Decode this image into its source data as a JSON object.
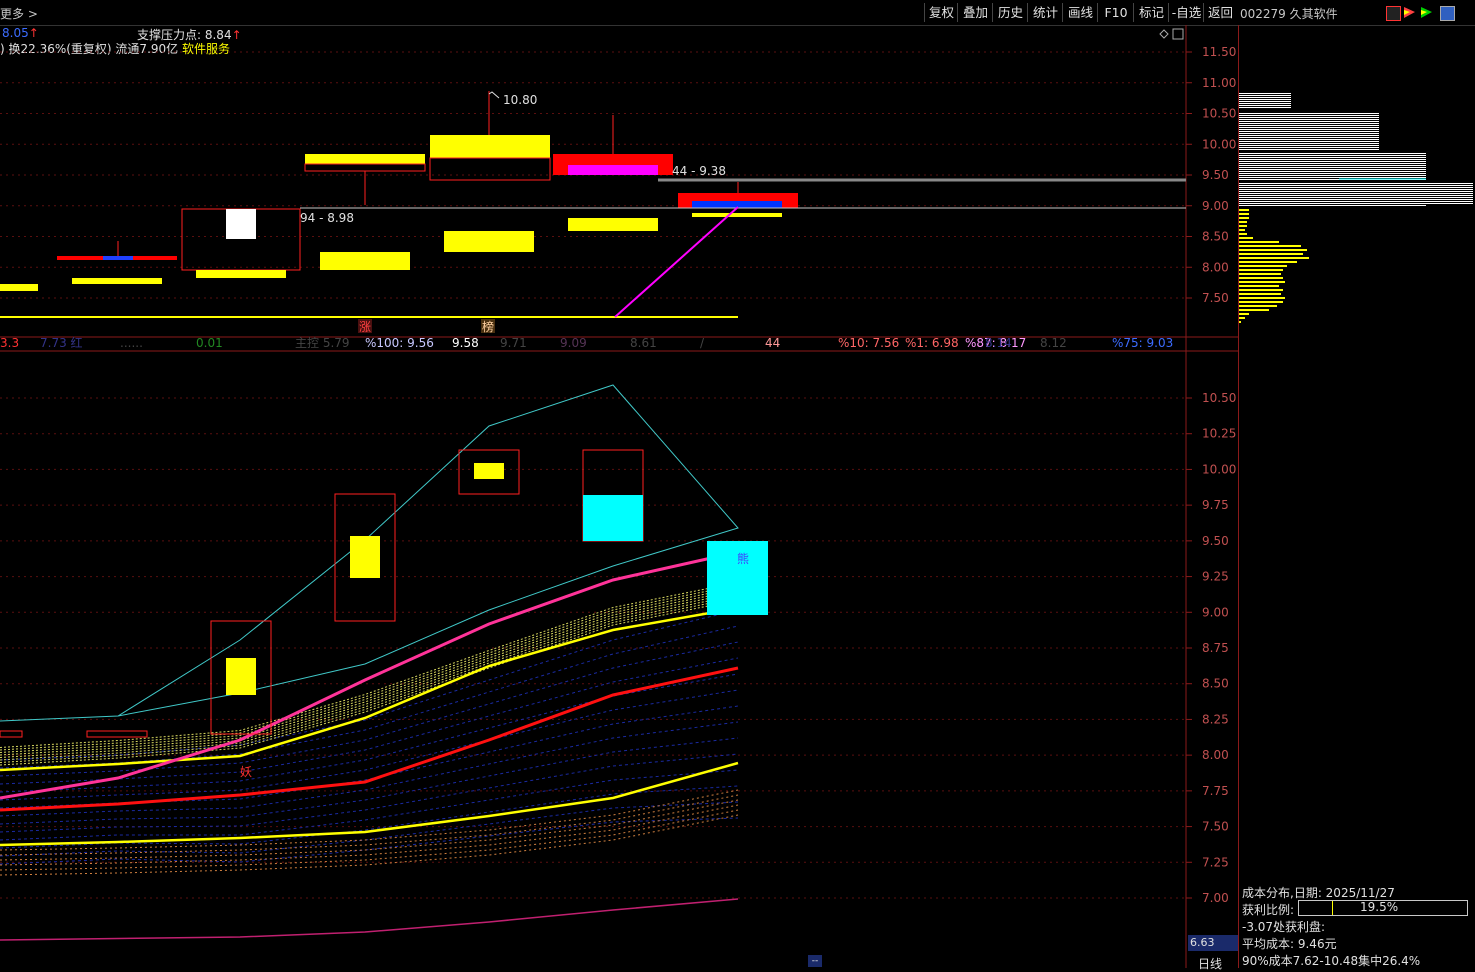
{
  "toolbar": {
    "more_label": "更多 >",
    "buttons": [
      "复权",
      "叠加",
      "历史",
      "统计",
      "画线",
      "F10",
      "标记",
      "-自选",
      "返回"
    ]
  },
  "stock": {
    "title": "002279 久其软件",
    "current_value": "8.05",
    "support_text": "支撑压力点: 8.84",
    "info_line_prefix": ") 换22.36%(重复权) 流通7.90亿 ",
    "sector": "软件服务"
  },
  "upper_chart": {
    "y_ticks": [
      "11.50",
      "11.00",
      "10.50",
      "10.00",
      "9.50",
      "9.00",
      "8.50",
      "8.00",
      "7.50"
    ],
    "annotations": [
      "10.80",
      "44 - 9.38",
      "94 - 8.98",
      "涨",
      "榜"
    ]
  },
  "indicator_strip": {
    "segments": [
      {
        "text": "3.3",
        "color": "#ff3333"
      },
      {
        "text": "%100: 9.56",
        "color": "#c8c8ff"
      },
      {
        "text": "9.58",
        "color": "#ffffff"
      },
      {
        "text": "44",
        "color": "#ff9999"
      },
      {
        "text": "%10: 7.56",
        "color": "#ff6666"
      },
      {
        "text": "%1: 6.98",
        "color": "#ff6666"
      },
      {
        "text": "%87: 8.17",
        "color": "#ff99ff"
      },
      {
        "text": "%75: 9.03",
        "color": "#3c6cff"
      }
    ]
  },
  "lower_chart": {
    "y_ticks": [
      "10.50",
      "10.25",
      "10.00",
      "9.75",
      "9.50",
      "9.25",
      "9.00",
      "8.75",
      "8.50",
      "8.25",
      "8.00",
      "7.75",
      "7.50",
      "7.25",
      "7.00"
    ],
    "labels": [
      "妖",
      "熊"
    ],
    "current_price": "6.63"
  },
  "cost_panel": {
    "title": "成本分布,日期: 2025/11/27",
    "profit_label": "获利比例:",
    "profit_value": "19.5%",
    "profit_fraction": 0.195,
    "profit_at": "-3.07处获利盘:",
    "avg_cost": "平均成本: 9.46元",
    "concentration": "90%成本7.62-10.48集中26.4%"
  },
  "footer": {
    "period_button": "日线",
    "scroll_marker": "--"
  },
  "colors": {
    "up": "#ff0000",
    "yellow": "#ffff00",
    "cyan": "#00ffff",
    "magenta": "#ff00ff",
    "pink": "#ff3399",
    "grid": "#8b1a1a"
  }
}
